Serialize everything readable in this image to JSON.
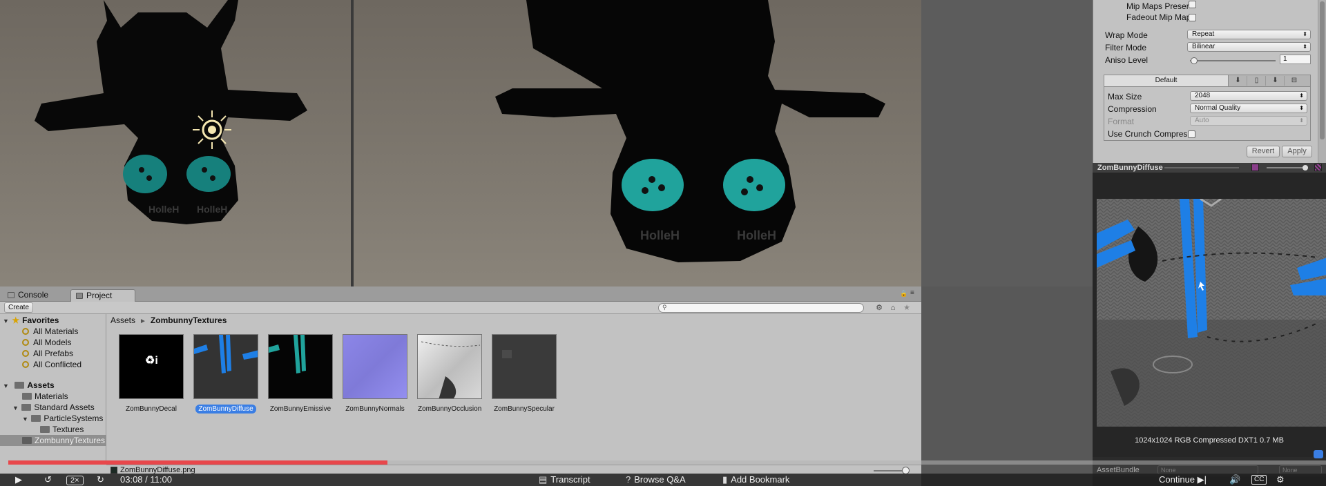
{
  "inspector": {
    "mip_maps_preserve": {
      "label": "Mip Maps Preser",
      "checked": false
    },
    "fadeout_mip_maps": {
      "label": "Fadeout Mip Map",
      "checked": false
    },
    "wrap_mode": {
      "label": "Wrap Mode",
      "value": "Repeat"
    },
    "filter_mode": {
      "label": "Filter Mode",
      "value": "Bilinear"
    },
    "aniso_level": {
      "label": "Aniso Level",
      "value": "1"
    },
    "platform_tab": "Default",
    "max_size": {
      "label": "Max Size",
      "value": "2048"
    },
    "compression": {
      "label": "Compression",
      "value": "Normal Quality"
    },
    "format": {
      "label": "Format",
      "value": "Auto"
    },
    "use_crunch": {
      "label": "Use Crunch Compres",
      "checked": false
    },
    "revert_label": "Revert",
    "apply_label": "Apply"
  },
  "preview": {
    "title": "ZomBunnyDiffuse",
    "info": "1024x1024  RGB Compressed DXT1   0.7 MB",
    "assetbundle_label": "AssetBundle",
    "assetbundle_value": "None",
    "assetbundle_variant": "None"
  },
  "tabs": {
    "console": "Console",
    "project": "Project"
  },
  "toolbar": {
    "create_label": "Create"
  },
  "tree": {
    "favorites_label": "Favorites",
    "favorites": [
      "All Materials",
      "All Models",
      "All Prefabs",
      "All Conflicted"
    ],
    "assets_label": "Assets",
    "materials": "Materials",
    "standard_assets": "Standard Assets",
    "particle_systems": "ParticleSystems",
    "textures": "Textures",
    "zombunny_textures": "ZombunnyTextures"
  },
  "breadcrumb": {
    "root": "Assets",
    "current": "ZombunnyTextures"
  },
  "assets": [
    {
      "name": "ZomBunnyDecal",
      "selected": false
    },
    {
      "name": "ZomBunnyDiffuse",
      "selected": true
    },
    {
      "name": "ZomBunnyEmissive",
      "selected": false
    },
    {
      "name": "ZomBunnyNormals",
      "selected": false
    },
    {
      "name": "ZomBunnyOcclusion",
      "selected": false
    },
    {
      "name": "ZomBunnySpecular",
      "selected": false
    }
  ],
  "path_bar": "ZomBunnyDiffuse.png",
  "player": {
    "progress_fraction": 0.2877,
    "speed": "2×",
    "time": "03:08 / 11:00",
    "transcript": "Transcript",
    "browse_qa": "Browse Q&A",
    "add_bookmark": "Add Bookmark",
    "continue": "Continue",
    "cc": "CC"
  },
  "colors": {
    "selection_blue": "#3a7ee4",
    "progress_red": "#e8474b",
    "teal_eyes": "#2fb7b0",
    "stripe_blue": "#1e7fe6"
  }
}
